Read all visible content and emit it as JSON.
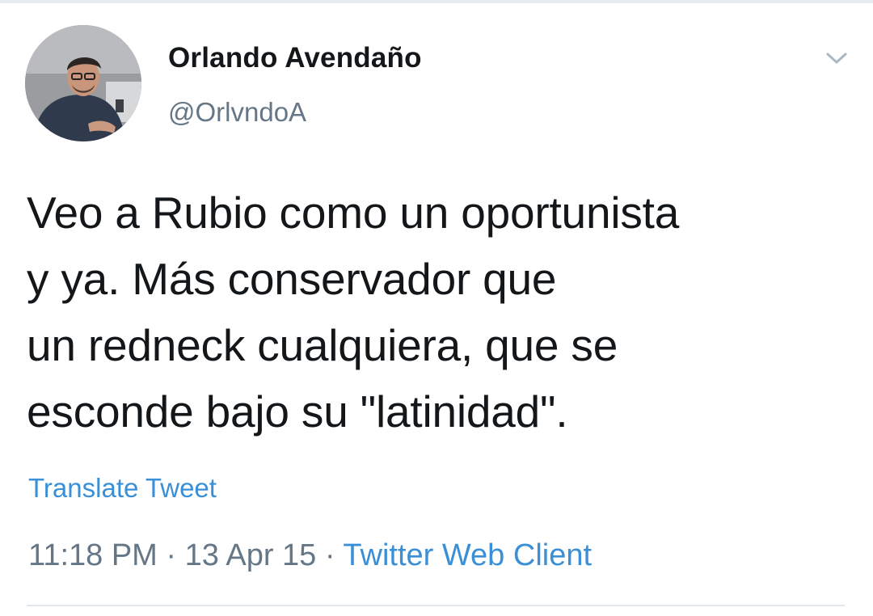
{
  "author": {
    "name": "Orlando Avendaño",
    "handle": "@OrlvndoA"
  },
  "tweet": {
    "text": "Veo a Rubio como un oportunista\ny ya. Más conservador que\nun redneck cualquiera, que se\nesconde bajo su \"latinidad\"."
  },
  "actions": {
    "translate_label": "Translate Tweet"
  },
  "meta": {
    "time": "11:18 PM",
    "separator_1": " · ",
    "date": "13 Apr 15",
    "separator_2": " · ",
    "client": "Twitter Web Client"
  },
  "icons": {
    "menu_caret": "chevron-down-icon"
  },
  "colors": {
    "link": "#3a8fd6",
    "secondary_text": "#657786",
    "primary_text": "#14171a"
  }
}
